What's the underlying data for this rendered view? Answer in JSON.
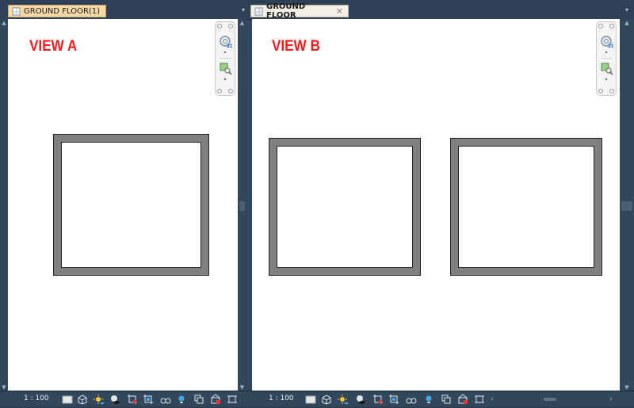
{
  "views": [
    {
      "tab_label": "GROUND FLOOR(1)",
      "tab_active": false,
      "annotation": "VIEW A",
      "scale": "1 : 100"
    },
    {
      "tab_label": "GROUND FLOOR",
      "tab_active": true,
      "close_glyph": "✕",
      "annotation": "VIEW B",
      "scale": "1 : 100"
    }
  ],
  "navigation_bar": {
    "buttons": [
      "steering-wheel-2d",
      "zoom-in-region"
    ]
  },
  "view_control_icons": [
    "visual-style",
    "3d-box",
    "sun-path",
    "shadows",
    "crop-view",
    "crop-region-hidden",
    "temporary-hide",
    "reveal-elements",
    "render",
    "worksharing",
    "analytical-model"
  ],
  "colors": {
    "annotation": "#ff1a1a",
    "wall_fill": "#808080",
    "canvas": "#ffffff",
    "chrome": "#32465a",
    "inactive_tab": "#f7d9a8",
    "active_tab": "#f2efe6"
  }
}
